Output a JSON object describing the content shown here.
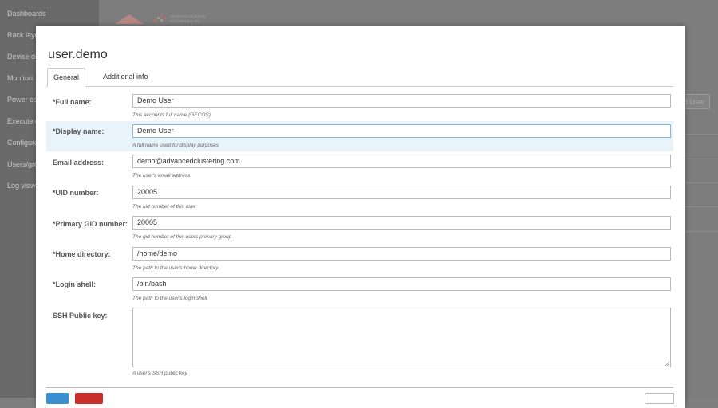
{
  "sidebar": {
    "items": [
      {
        "label": "Dashboards"
      },
      {
        "label": "Rack layo"
      },
      {
        "label": "Device de"
      },
      {
        "label": "Monitori"
      },
      {
        "label": "Power co"
      },
      {
        "label": "Execute c"
      },
      {
        "label": "Configura"
      },
      {
        "label": "Users/gro"
      },
      {
        "label": "Log view"
      }
    ]
  },
  "header": {
    "logo_text_line1": "advanced clustering",
    "logo_text_line2": "technologies, inc.",
    "add_user_button": "d User"
  },
  "modal": {
    "title": "user.demo",
    "tabs": [
      {
        "label": "General"
      },
      {
        "label": "Additional info"
      }
    ],
    "fields": [
      {
        "label": "*Full name:",
        "value": "Demo User",
        "help": "This accounts full name (GECOS)"
      },
      {
        "label": "*Display name:",
        "value": "Demo User",
        "help": "A full name used for display purposes"
      },
      {
        "label": "Email address:",
        "value": "demo@advancedclustering.com",
        "help": "The user's email address"
      },
      {
        "label": "*UID number:",
        "value": "20005",
        "help": "The uid number of this user"
      },
      {
        "label": "*Primary GID number:",
        "value": "20005",
        "help": "The gid number of this users primary group"
      },
      {
        "label": "*Home directory:",
        "value": "/home/demo",
        "help": "The path to the user's home directory"
      },
      {
        "label": "*Login shell:",
        "value": "/bin/bash",
        "help": "The path to the user's login shell"
      }
    ],
    "ssh": {
      "label": "SSH Public key:",
      "value": "",
      "help": "A user's SSH public key"
    }
  },
  "colors": {
    "primary": "#3a8fd0",
    "danger": "#c9302c",
    "highlight": "#e9f3fa"
  }
}
